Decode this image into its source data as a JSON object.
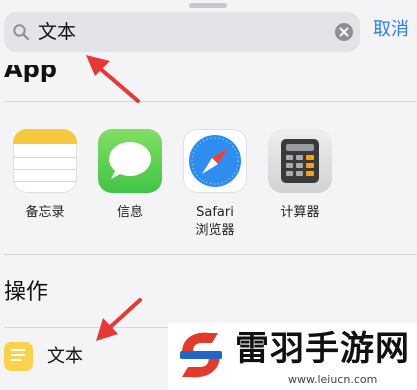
{
  "search": {
    "value": "文本",
    "cancel_label": "取消"
  },
  "sections": {
    "apps_title": "App",
    "actions_title": "操作"
  },
  "apps": [
    {
      "label": "备忘录",
      "icon": "notes-icon"
    },
    {
      "label": "信息",
      "icon": "messages-icon"
    },
    {
      "label": "Safari\n浏览器",
      "icon": "safari-icon"
    },
    {
      "label": "计算器",
      "icon": "calculator-icon"
    }
  ],
  "actions": [
    {
      "label": "文本",
      "icon": "text-action-icon"
    }
  ],
  "watermark": {
    "title": "雷羽手游网",
    "url": "www.leiucn.com"
  },
  "colors": {
    "accent": "#2c7df4",
    "annotation": "#e53935",
    "text_action": "#f9d24e"
  }
}
